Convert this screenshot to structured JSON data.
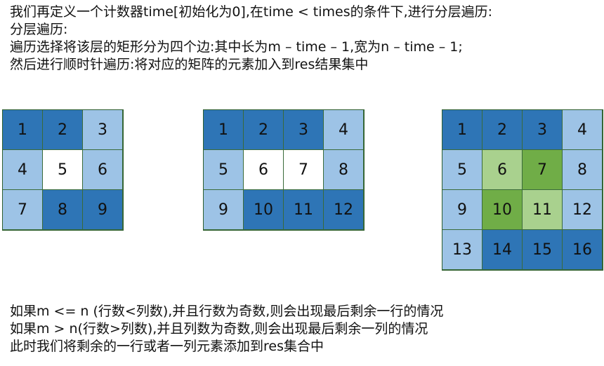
{
  "intro": [
    "我们再定义一个计数器time[初始化为0],在time  < times的条件下,进行分层遍历:",
    "分层遍历:",
    "遍历选择将该层的矩形分为四个边:其中长为m  – time – 1,宽为n – time – 1;",
    "然后进行顺时针遍历:将对应的矩阵的元素加入到res结果集中"
  ],
  "grids": [
    {
      "id": "grid-3x3",
      "cells": [
        {
          "v": "1",
          "color": "dark"
        },
        {
          "v": "2",
          "color": "dark"
        },
        {
          "v": "3",
          "color": "light"
        },
        {
          "v": "4",
          "color": "light"
        },
        {
          "v": "5",
          "color": "white"
        },
        {
          "v": "6",
          "color": "light"
        },
        {
          "v": "7",
          "color": "light"
        },
        {
          "v": "8",
          "color": "dark"
        },
        {
          "v": "9",
          "color": "dark"
        }
      ]
    },
    {
      "id": "grid-3x4",
      "cells": [
        {
          "v": "1",
          "color": "dark"
        },
        {
          "v": "2",
          "color": "dark"
        },
        {
          "v": "3",
          "color": "dark"
        },
        {
          "v": "4",
          "color": "light"
        },
        {
          "v": "5",
          "color": "light"
        },
        {
          "v": "6",
          "color": "white"
        },
        {
          "v": "7",
          "color": "white"
        },
        {
          "v": "8",
          "color": "light"
        },
        {
          "v": "9",
          "color": "light"
        },
        {
          "v": "10",
          "color": "dark"
        },
        {
          "v": "11",
          "color": "dark"
        },
        {
          "v": "12",
          "color": "dark"
        }
      ]
    },
    {
      "id": "grid-4x4",
      "cells": [
        {
          "v": "1",
          "color": "dark"
        },
        {
          "v": "2",
          "color": "dark"
        },
        {
          "v": "3",
          "color": "dark"
        },
        {
          "v": "4",
          "color": "light"
        },
        {
          "v": "5",
          "color": "light"
        },
        {
          "v": "6",
          "color": "lgreen"
        },
        {
          "v": "7",
          "color": "dgreen"
        },
        {
          "v": "8",
          "color": "light"
        },
        {
          "v": "9",
          "color": "light"
        },
        {
          "v": "10",
          "color": "dgreen"
        },
        {
          "v": "11",
          "color": "lgreen"
        },
        {
          "v": "12",
          "color": "light"
        },
        {
          "v": "13",
          "color": "light"
        },
        {
          "v": "14",
          "color": "dark"
        },
        {
          "v": "15",
          "color": "dark"
        },
        {
          "v": "16",
          "color": "dark"
        }
      ]
    }
  ],
  "notes": [
    "如果m <= n (行数<列数),并且行数为奇数,则会出现最后剩余一行的情况",
    "如果m > n(行数>列数),并且列数为奇数,则会出现最后剩余一列的情况",
    "此时我们将剩余的一行或者一列元素添加到res集合中"
  ],
  "colors": {
    "dark": "#2e75b6",
    "light": "#9dc3e6",
    "white": "#ffffff",
    "lgreen": "#a9d18e",
    "dgreen": "#70ad47"
  }
}
